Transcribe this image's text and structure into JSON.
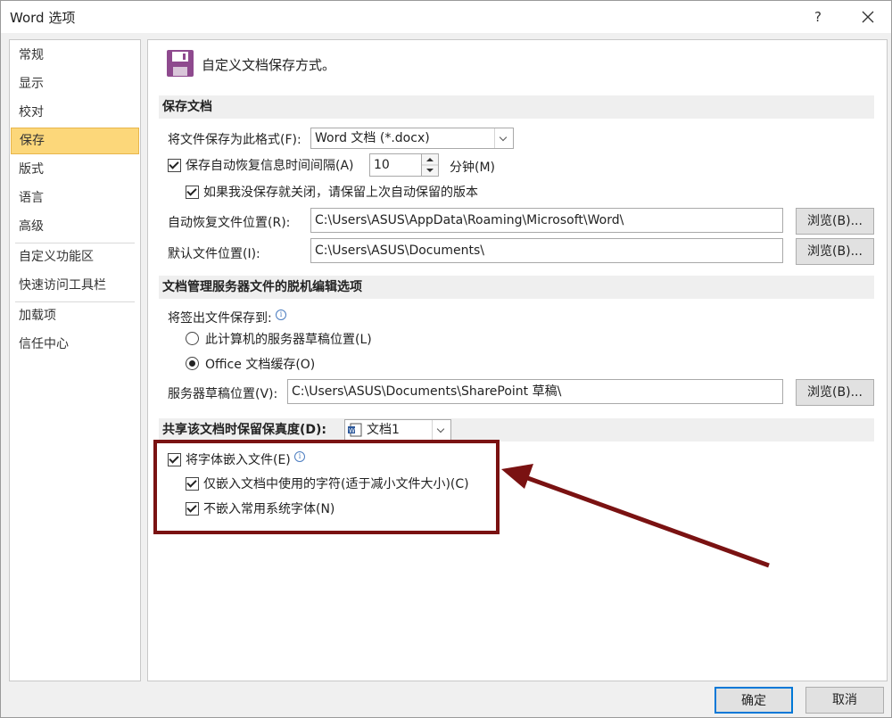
{
  "window": {
    "title": "Word 选项",
    "help": "?"
  },
  "nav": {
    "items": [
      {
        "label": "常规"
      },
      {
        "label": "显示"
      },
      {
        "label": "校对"
      },
      {
        "label": "保存"
      },
      {
        "label": "版式"
      },
      {
        "label": "语言"
      },
      {
        "label": "高级"
      },
      {
        "label": "自定义功能区"
      },
      {
        "label": "快速访问工具栏"
      },
      {
        "label": "加载项"
      },
      {
        "label": "信任中心"
      }
    ],
    "selected": "保存"
  },
  "header": {
    "title": "自定义文档保存方式。",
    "icon": "save-disk-icon"
  },
  "save_section": {
    "title": "保存文档",
    "format_label": "将文件保存为此格式(F):",
    "format_value": "Word 文档 (*.docx)",
    "autorecover_label": "保存自动恢复信息时间间隔(A)",
    "autorecover_checked": true,
    "autorecover_value": "10",
    "minutes_label": "分钟(M)",
    "keep_last_label": "如果我没保存就关闭，请保留上次自动保留的版本",
    "keep_last_checked": true,
    "autorecover_location_label": "自动恢复文件位置(R):",
    "autorecover_location_value": "C:\\Users\\ASUS\\AppData\\Roaming\\Microsoft\\Word\\",
    "default_location_label": "默认文件位置(I):",
    "default_location_value": "C:\\Users\\ASUS\\Documents\\",
    "browse_label": "浏览(B)..."
  },
  "offline_section": {
    "title": "文档管理服务器文件的脱机编辑选项",
    "save_checkout_label": "将签出文件保存到:",
    "radio_server_label": "此计算机的服务器草稿位置(L)",
    "radio_cache_label": "Office 文档缓存(O)",
    "selected_radio": "Office 文档缓存(O)",
    "drafts_label": "服务器草稿位置(V):",
    "drafts_value": "C:\\Users\\ASUS\\Documents\\SharePoint 草稿\\",
    "browse_label": "浏览(B)..."
  },
  "fidelity_section": {
    "title": "共享该文档时保留保真度(D):",
    "document_value": "文档1",
    "embed_fonts_label": "将字体嵌入文件(E)",
    "embed_fonts_checked": true,
    "embed_used_label": "仅嵌入文档中使用的字符(适于减小文件大小)(C)",
    "embed_used_checked": true,
    "no_common_label": "不嵌入常用系统字体(N)",
    "no_common_checked": true
  },
  "footer": {
    "ok_label": "确定",
    "cancel_label": "取消"
  },
  "colors": {
    "nav_selected": "#fcd77a",
    "annotation": "#7a1212"
  }
}
